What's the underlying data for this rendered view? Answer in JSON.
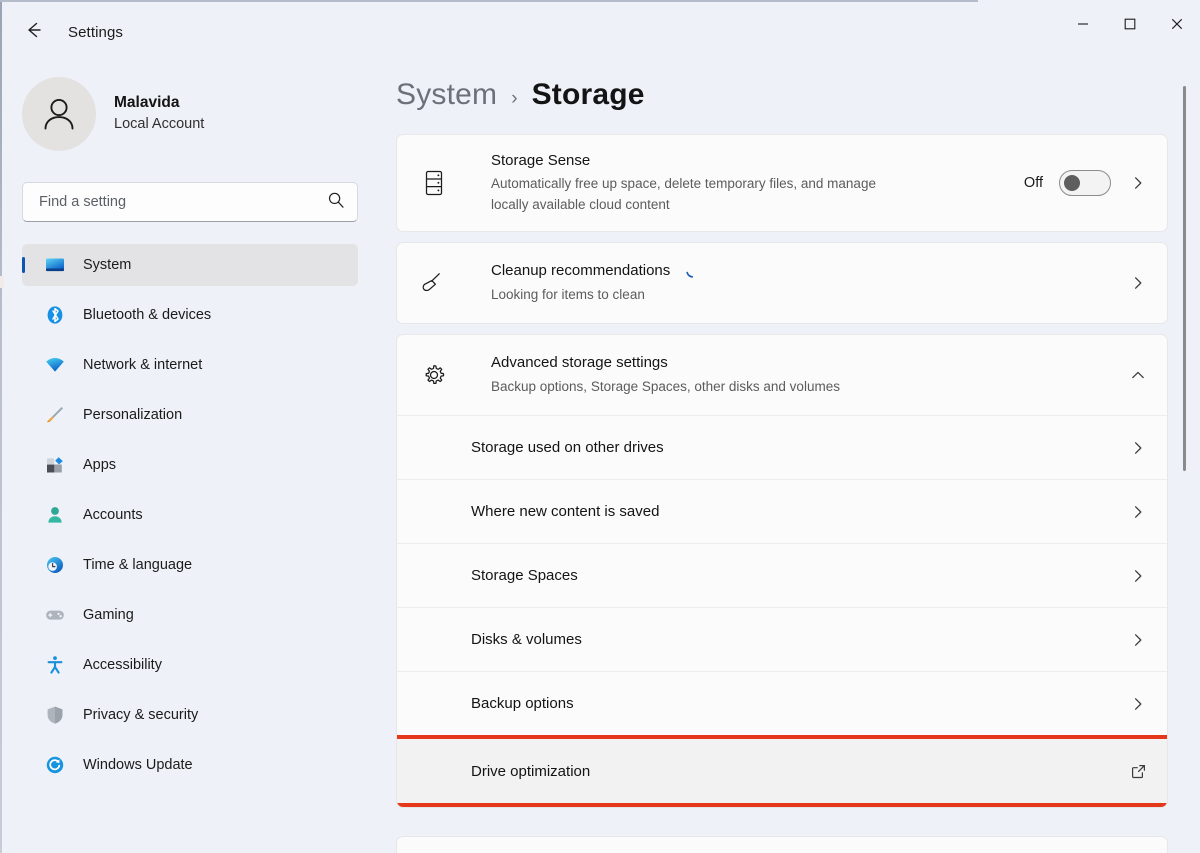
{
  "window": {
    "app_title": "Settings",
    "back_icon": "back-arrow-icon",
    "minimize_label": "Minimize",
    "maximize_label": "Maximize",
    "close_label": "Close"
  },
  "account": {
    "name": "Malavida",
    "subtitle": "Local Account",
    "avatar_icon": "person-icon"
  },
  "search": {
    "placeholder": "Find a setting",
    "value": "",
    "icon": "search-icon"
  },
  "sidebar": {
    "items": [
      {
        "label": "System",
        "icon": "display-monitor-icon",
        "active": true
      },
      {
        "label": "Bluetooth & devices",
        "icon": "bluetooth-icon",
        "active": false
      },
      {
        "label": "Network & internet",
        "icon": "wifi-icon",
        "active": false
      },
      {
        "label": "Personalization",
        "icon": "paintbrush-icon",
        "active": false
      },
      {
        "label": "Apps",
        "icon": "apps-grid-icon",
        "active": false
      },
      {
        "label": "Accounts",
        "icon": "account-person-icon",
        "active": false
      },
      {
        "label": "Time & language",
        "icon": "clock-globe-icon",
        "active": false
      },
      {
        "label": "Gaming",
        "icon": "gamepad-icon",
        "active": false
      },
      {
        "label": "Accessibility",
        "icon": "accessibility-icon",
        "active": false
      },
      {
        "label": "Privacy & security",
        "icon": "shield-icon",
        "active": false
      },
      {
        "label": "Windows Update",
        "icon": "update-refresh-icon",
        "active": false
      }
    ]
  },
  "breadcrumb": {
    "parent": "System",
    "separator": "›",
    "current": "Storage"
  },
  "main": {
    "storage_sense": {
      "title": "Storage Sense",
      "subtitle": "Automatically free up space, delete temporary files, and manage locally available cloud content",
      "icon": "storage-drive-icon",
      "toggle_state_label": "Off",
      "chevron": "chevron-right-icon"
    },
    "cleanup": {
      "title": "Cleanup recommendations",
      "subtitle": "Looking for items to clean",
      "icon": "broom-icon",
      "busy_icon": "loading-spinner-icon",
      "chevron": "chevron-right-icon"
    },
    "advanced": {
      "title": "Advanced storage settings",
      "subtitle": "Backup options, Storage Spaces, other disks and volumes",
      "icon": "gear-icon",
      "expanded": true,
      "expander_icon": "chevron-up-icon",
      "sub_items": [
        {
          "label": "Storage used on other drives",
          "trailing_icon": "chevron-right-icon",
          "highlighted": false
        },
        {
          "label": "Where new content is saved",
          "trailing_icon": "chevron-right-icon",
          "highlighted": false
        },
        {
          "label": "Storage Spaces",
          "trailing_icon": "chevron-right-icon",
          "highlighted": false
        },
        {
          "label": "Disks & volumes",
          "trailing_icon": "chevron-right-icon",
          "highlighted": false
        },
        {
          "label": "Backup options",
          "trailing_icon": "chevron-right-icon",
          "highlighted": false
        },
        {
          "label": "Drive optimization",
          "trailing_icon": "external-link-icon",
          "highlighted": true
        }
      ]
    }
  },
  "colors": {
    "page_background": "#eef1f8",
    "card_background": "#fbfbfb",
    "accent_blue": "#0f56b3",
    "highlight_red": "#e5381a",
    "active_nav_background": "#e3e3e5",
    "spinner_blue": "#1a5fb4"
  },
  "scrollbar": {
    "name": "vertical-scrollbar"
  }
}
